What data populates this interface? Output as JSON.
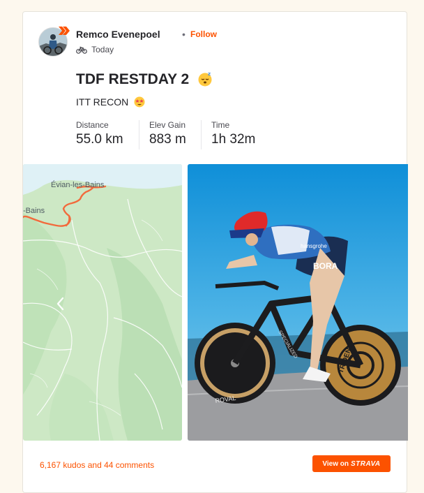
{
  "athlete": {
    "name": "Remco Evenepoel",
    "separator": "•",
    "follow_label": "Follow",
    "activity_icon": "bike-icon",
    "date": "Today"
  },
  "activity": {
    "title": "TDF RESTDAY 2",
    "title_emoji": "sleeping-face-emoji",
    "description": "ITT RECON",
    "description_emoji": "star-struck-emoji",
    "stats": [
      {
        "label": "Distance",
        "value": "55.0 km"
      },
      {
        "label": "Elev Gain",
        "value": "883 m"
      },
      {
        "label": "Time",
        "value": "1h 32m"
      }
    ]
  },
  "map": {
    "labels": [
      "Évian-les-Bains",
      "-Bains"
    ],
    "route_color": "#f26a3c"
  },
  "photo": {
    "jersey_text": "hansgrohe",
    "shorts_text": "BORA",
    "frame_text": "SPECIALIZED",
    "wheel_text": "ROVAL",
    "disc_text": "TRIDENT"
  },
  "footer": {
    "kudos_text": "6,167 kudos and 44 comments",
    "view_label": "View on",
    "brand": "STRAVA"
  },
  "colors": {
    "accent": "#fc5200",
    "background": "#fdf8ee",
    "card": "#ffffff"
  }
}
